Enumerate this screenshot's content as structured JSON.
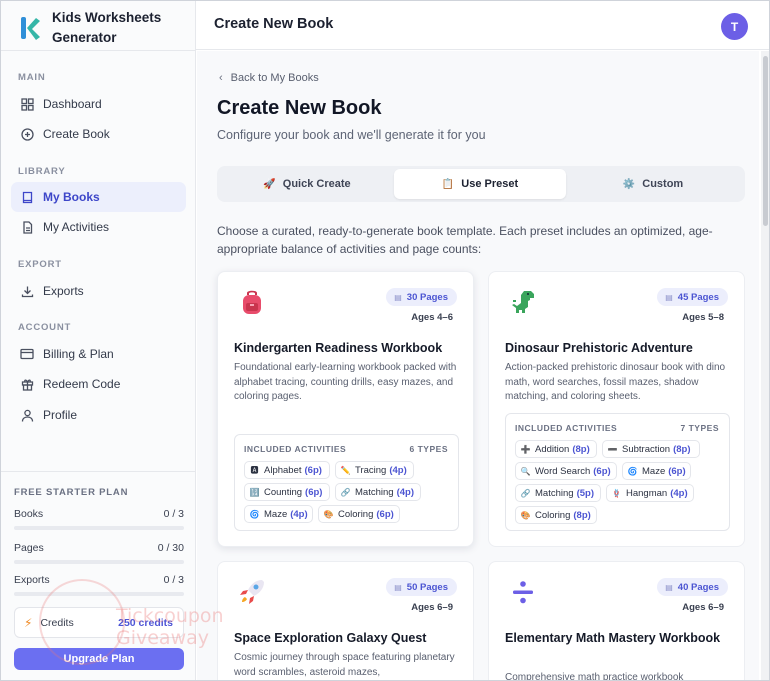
{
  "brand": {
    "title_line1": "Kids Worksheets",
    "title_line2": "Generator"
  },
  "sidebar": {
    "sections": [
      {
        "label": "MAIN",
        "items": [
          {
            "label": "Dashboard",
            "icon": "grid-icon"
          },
          {
            "label": "Create Book",
            "icon": "plus-circle-icon"
          }
        ]
      },
      {
        "label": "LIBRARY",
        "items": [
          {
            "label": "My Books",
            "icon": "book-icon",
            "active": true
          },
          {
            "label": "My Activities",
            "icon": "file-icon"
          }
        ]
      },
      {
        "label": "EXPORT",
        "items": [
          {
            "label": "Exports",
            "icon": "download-icon"
          }
        ]
      },
      {
        "label": "ACCOUNT",
        "items": [
          {
            "label": "Billing & Plan",
            "icon": "credit-card-icon"
          },
          {
            "label": "Redeem Code",
            "icon": "gift-icon"
          },
          {
            "label": "Profile",
            "icon": "user-icon"
          }
        ]
      }
    ],
    "plan": {
      "title": "FREE STARTER PLAN",
      "usage": [
        {
          "label": "Books",
          "value": "0 / 3"
        },
        {
          "label": "Pages",
          "value": "0 / 30"
        },
        {
          "label": "Exports",
          "value": "0 / 3"
        }
      ],
      "credits_label": "Credits",
      "credits_value": "250 credits",
      "upgrade_label": "Upgrade Plan"
    }
  },
  "topbar": {
    "title": "Create New Book",
    "avatar_initial": "T"
  },
  "main": {
    "back_label": "Back to My Books",
    "title": "Create New Book",
    "subtitle": "Configure your book and we'll generate it for you",
    "tabs": [
      {
        "label": "Quick Create",
        "icon": "🚀"
      },
      {
        "label": "Use Preset",
        "icon": "📋",
        "active": true
      },
      {
        "label": "Custom",
        "icon": "⚙️"
      }
    ],
    "intro": "Choose a curated, ready-to-generate book template. Each preset includes an optimized, age-appropriate balance of activities and page counts:",
    "cards": [
      {
        "icon": "backpack-icon",
        "pages": "30 Pages",
        "ages": "Ages 4–6",
        "title": "Kindergarten Readiness Workbook",
        "desc": "Foundational early-learning workbook packed with alphabet tracing, counting drills, easy mazes, and coloring pages.",
        "acts_label": "INCLUDED ACTIVITIES",
        "acts_count": "6 TYPES",
        "chips": [
          {
            "icon": "🅰",
            "label": "Alphabet",
            "pages": "(6p)"
          },
          {
            "icon": "✏️",
            "label": "Tracing",
            "pages": "(4p)"
          },
          {
            "icon": "🔢",
            "label": "Counting",
            "pages": "(6p)"
          },
          {
            "icon": "🔗",
            "label": "Matching",
            "pages": "(4p)"
          },
          {
            "icon": "🌀",
            "label": "Maze",
            "pages": "(4p)"
          },
          {
            "icon": "🎨",
            "label": "Coloring",
            "pages": "(6p)"
          }
        ]
      },
      {
        "icon": "dinosaur-icon",
        "pages": "45 Pages",
        "ages": "Ages 5–8",
        "title": "Dinosaur Prehistoric Adventure",
        "desc": "Action-packed prehistoric dinosaur book with dino math, word searches, fossil mazes, shadow matching, and coloring sheets.",
        "acts_label": "INCLUDED ACTIVITIES",
        "acts_count": "7 TYPES",
        "chips": [
          {
            "icon": "➕",
            "label": "Addition",
            "pages": "(8p)"
          },
          {
            "icon": "➖",
            "label": "Subtraction",
            "pages": "(8p)"
          },
          {
            "icon": "🔍",
            "label": "Word Search",
            "pages": "(6p)"
          },
          {
            "icon": "🌀",
            "label": "Maze",
            "pages": "(6p)"
          },
          {
            "icon": "🔗",
            "label": "Matching",
            "pages": "(5p)"
          },
          {
            "icon": "🪢",
            "label": "Hangman",
            "pages": "(4p)"
          },
          {
            "icon": "🎨",
            "label": "Coloring",
            "pages": "(8p)"
          }
        ]
      },
      {
        "icon": "rocket-icon",
        "pages": "50 Pages",
        "ages": "Ages 6–9",
        "title": "Space Exploration Galaxy Quest",
        "desc": "Cosmic journey through space featuring planetary word scrambles, asteroid mazes,"
      },
      {
        "icon": "divide-icon",
        "pages": "40 Pages",
        "ages": "Ages 6–9",
        "title": "Elementary Math Mastery Workbook",
        "desc": "Comprehensive math practice workbook"
      }
    ]
  },
  "watermark": {
    "line1": "Tickcoupon",
    "line2": "Giveaway"
  },
  "colors": {
    "accent": "#4d55d6",
    "button": "#6b6ff1",
    "avatar": "#6c5fe6"
  }
}
